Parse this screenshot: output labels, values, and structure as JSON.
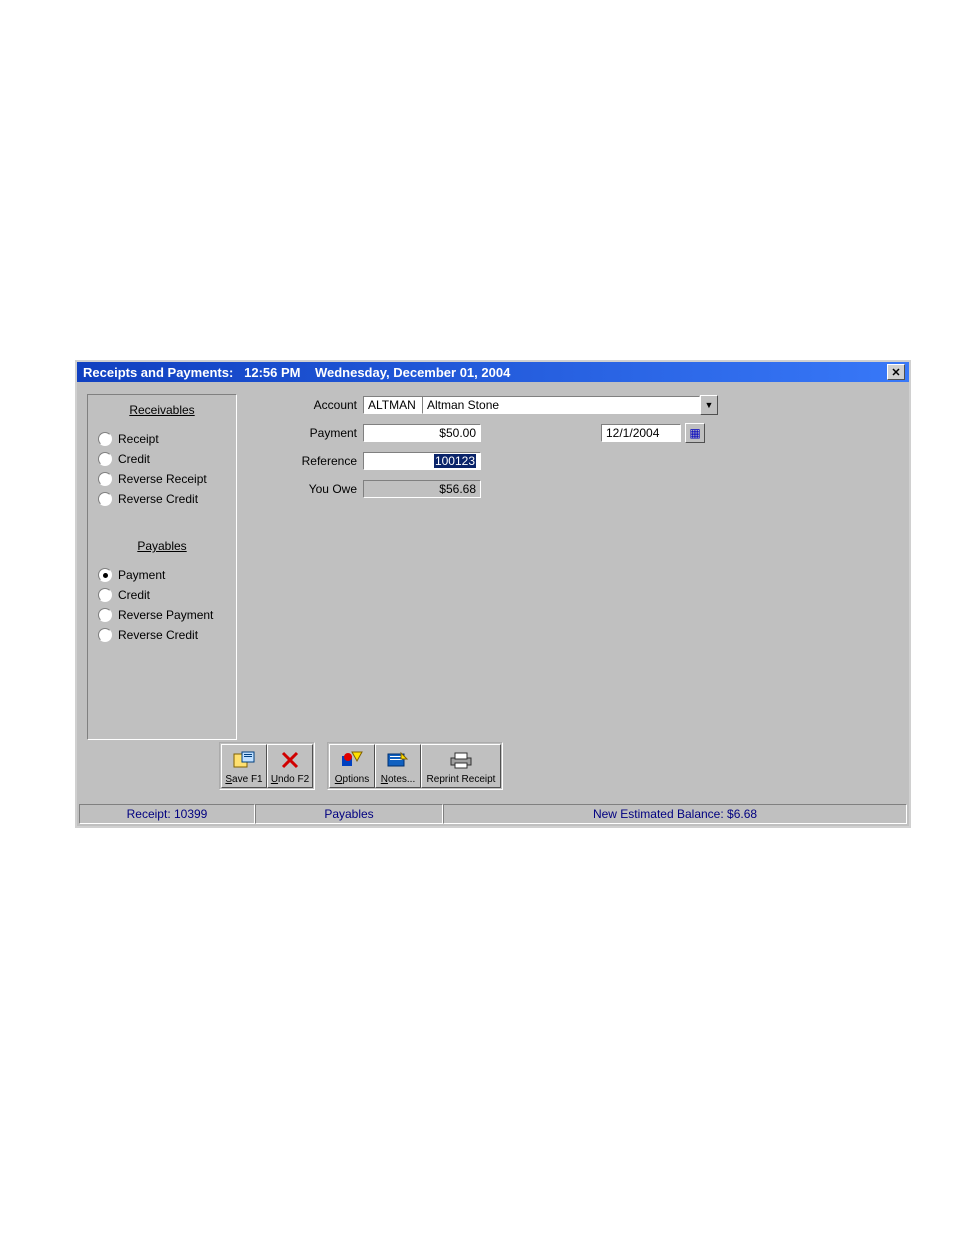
{
  "titlebar": {
    "prefix": "Receipts and Payments:   ",
    "time": "12:56 PM",
    "gap": "    ",
    "date": "Wednesday, December 01, 2004"
  },
  "sidebar": {
    "receivables_heading": "Receivables",
    "payables_heading": "Payables",
    "receivables": [
      {
        "label": "Receipt",
        "selected": false
      },
      {
        "label": "Credit",
        "selected": false
      },
      {
        "label": "Reverse Receipt",
        "selected": false
      },
      {
        "label": "Reverse Credit",
        "selected": false
      }
    ],
    "payables": [
      {
        "label": "Payment",
        "selected": true
      },
      {
        "label": "Credit",
        "selected": false
      },
      {
        "label": "Reverse Payment",
        "selected": false
      },
      {
        "label": "Reverse Credit",
        "selected": false
      }
    ]
  },
  "fields": {
    "account_label": "Account",
    "account_code": "ALTMAN",
    "account_name": "Altman Stone",
    "payment_label": "Payment",
    "payment_value": "$50.00",
    "date_value": "12/1/2004",
    "reference_label": "Reference",
    "reference_value": "100123",
    "youowe_label": "You Owe",
    "youowe_value": "$56.68"
  },
  "toolbar": {
    "save": "Save F1",
    "undo": "Undo F2",
    "options": "Options",
    "notes": "Notes...",
    "reprint": "Reprint Receipt"
  },
  "status": {
    "receipt": "Receipt:  10399",
    "middle": "Payables",
    "balance": "New Estimated Balance:  $6.68"
  },
  "icons": {
    "close": "✕",
    "dropdown": "▼",
    "calendar": "▦"
  }
}
